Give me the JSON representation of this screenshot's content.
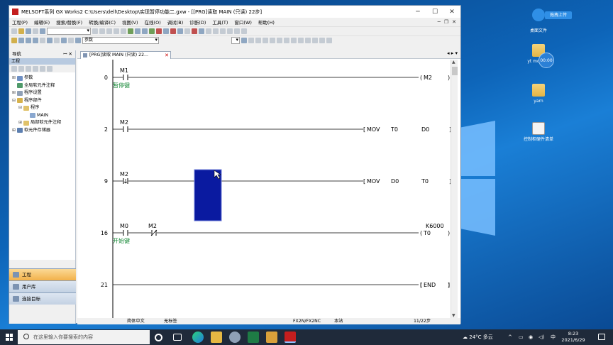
{
  "window": {
    "title": "MELSOFT系列 GX Works2 C:\\Users\\dell\\Desktop\\实现暂停功能二.gxw - [[PRG]读取 MAIN (只读) 22步]",
    "controls": [
      "─",
      "☐",
      "✕"
    ]
  },
  "menu": {
    "items": [
      "工程(P)",
      "编辑(E)",
      "搜索/替换(F)",
      "转换/编译(C)",
      "视图(V)",
      "在线(O)",
      "调试(B)",
      "诊断(D)",
      "工具(T)",
      "窗口(W)",
      "帮助(H)"
    ],
    "mdi_controls": [
      "─",
      "❐",
      "✕"
    ]
  },
  "toolbar": {
    "combo1": "",
    "combo2": "",
    "combo3": "参数",
    "combo4": ""
  },
  "nav": {
    "title": "导航",
    "pin": "ꟷ ✕",
    "section": "工程",
    "tree": [
      {
        "label": "参数",
        "indent": 0,
        "exp": "⊞"
      },
      {
        "label": "全局软元件注释",
        "indent": 0,
        "exp": ""
      },
      {
        "label": "程序设置",
        "indent": 0,
        "exp": "⊞"
      },
      {
        "label": "程序部件",
        "indent": 0,
        "exp": "⊟"
      },
      {
        "label": "程序",
        "indent": 1,
        "exp": "⊟"
      },
      {
        "label": "MAIN",
        "indent": 2,
        "exp": ""
      },
      {
        "label": "局部软元件注释",
        "indent": 1,
        "exp": "⊞"
      },
      {
        "label": "软元件存储器",
        "indent": 0,
        "exp": "⊞"
      }
    ],
    "buttons": [
      {
        "label": "工程",
        "active": true
      },
      {
        "label": "用户库",
        "active": false
      },
      {
        "label": "连接目标",
        "active": false
      }
    ]
  },
  "doc_tab": {
    "label": "[PRG]读取 MAIN (只读) 22...",
    "close": "✕",
    "arrows": "◂ ▸ ▾"
  },
  "ladder": {
    "rungs": [
      {
        "step": "0",
        "contacts": [
          {
            "dev": "M1",
            "type": "NO",
            "comment": "暂停键"
          }
        ],
        "output": {
          "kind": "coil",
          "text": "M2"
        }
      },
      {
        "step": "2",
        "contacts": [
          {
            "dev": "M2",
            "type": "NO",
            "comment": ""
          }
        ],
        "output": {
          "kind": "inst",
          "op": "MOV",
          "a": "T0",
          "b": "D0"
        }
      },
      {
        "step": "9",
        "contacts": [
          {
            "dev": "M2",
            "type": "FALL",
            "comment": ""
          }
        ],
        "output": {
          "kind": "inst",
          "op": "MOV",
          "a": "D0",
          "b": "T0"
        }
      },
      {
        "step": "16",
        "contacts": [
          {
            "dev": "M0",
            "type": "NO",
            "comment": "开始键"
          },
          {
            "dev": "M2",
            "type": "NC",
            "comment": ""
          }
        ],
        "output": {
          "kind": "timer",
          "text": "T0",
          "const": "K6000"
        }
      },
      {
        "step": "21",
        "contacts": [],
        "output": {
          "kind": "end",
          "text": "END"
        }
      }
    ]
  },
  "status": {
    "lang": "简体中文",
    "label": "无标签",
    "cpu": "FX2N/FX2NC",
    "station": "本站",
    "steps": "11/22步"
  },
  "desktop": {
    "cloud_button": "拖拽上传",
    "timer_badge": "00:00",
    "icons": [
      "桌面文件",
      "yt monitor",
      "yarn",
      "控制柜硬件清单"
    ]
  },
  "taskbar": {
    "search_placeholder": "在这里输入你要搜索的内容",
    "weather": "24°C 多云",
    "ime": "中",
    "time": "8:23",
    "date": "2021/6/29",
    "tray_arrow": "^"
  }
}
